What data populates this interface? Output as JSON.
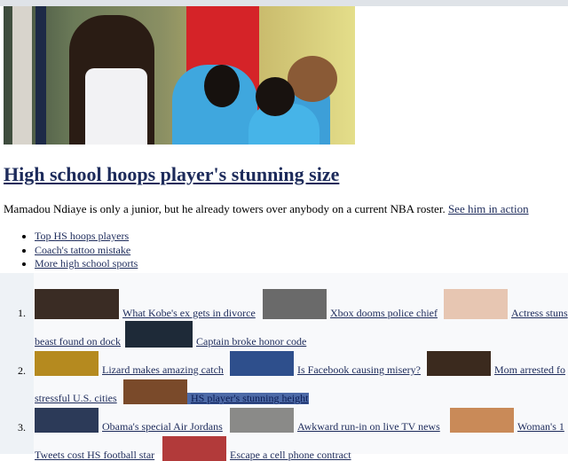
{
  "hero": {
    "headline": "High school hoops player's stunning size",
    "description": "Mamadou Ndiaye is only a junior, but he already towers over anybody on a current NBA roster.",
    "action_link": "See him in action"
  },
  "bullets": [
    "Top HS hoops players",
    "Coach's tattoo mistake",
    "More high school sports"
  ],
  "list_numbers": [
    "1.",
    "2.",
    "3."
  ],
  "rows": [
    {
      "line1": [
        {
          "label": "What Kobe's ex gets in divorce",
          "thumb": "group-photo-thumbnail",
          "color": "#3a2c24"
        },
        {
          "label": "Xbox dooms police chief",
          "thumb": "man-portrait-thumbnail",
          "color": "#6a6a6a"
        },
        {
          "label": "Actress stuns",
          "thumb": "blonde-woman-thumbnail",
          "color": "#e7c6b2"
        }
      ],
      "line2": [
        {
          "label": "beast found on dock",
          "thumb": "",
          "color": ""
        },
        {
          "label": "Captain broke honor code",
          "thumb": "captain-portrait-thumbnail",
          "color": "#1e2a38"
        }
      ]
    },
    {
      "line1": [
        {
          "label": "Lizard makes amazing catch",
          "thumb": "lizard-thumbnail",
          "color": "#b58a1f"
        },
        {
          "label": "Is Facebook causing misery?",
          "thumb": "facebook-screen-thumbnail",
          "color": "#2e4f8c"
        },
        {
          "label": "Mom arrested fo",
          "thumb": "woman-portrait-thumbnail",
          "color": "#3b2a1e"
        }
      ],
      "line2": [
        {
          "label": "stressful U.S. cities",
          "thumb": "",
          "color": ""
        },
        {
          "label": "HS player's stunning height",
          "thumb": "basketball-player-thumbnail",
          "color": "#7a4a2a"
        }
      ]
    },
    {
      "line1": [
        {
          "label": "Obama's special Air Jordans",
          "thumb": "obama-thumbnail",
          "color": "#2c3a58"
        },
        {
          "label": "Awkward run-in on live TV news",
          "thumb": "tv-news-thumbnail",
          "color": "#8a8a88"
        },
        {
          "label": "Woman's 1",
          "thumb": "smiling-woman-thumbnail",
          "color": "#c98a58"
        }
      ],
      "line2": [
        {
          "label": "Tweets cost HS football star",
          "thumb": "",
          "color": ""
        },
        {
          "label": "Escape a cell phone contract",
          "thumb": "cell-phones-thumbnail",
          "color": "#b23a3a"
        }
      ]
    }
  ],
  "colors": {
    "link": "#1d2b5b",
    "highlight": "#4d6aa7",
    "lower_bg": "#eef2f6"
  }
}
